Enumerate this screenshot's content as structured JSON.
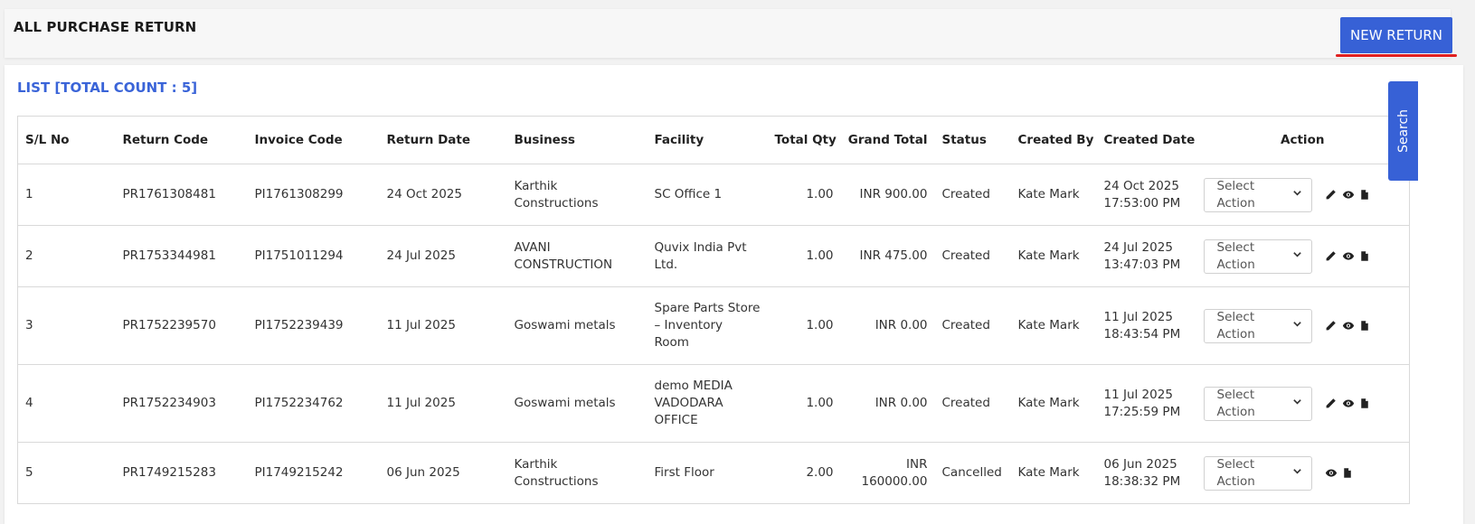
{
  "header": {
    "title": "ALL PURCHASE RETURN",
    "new_return_label": "NEW RETURN"
  },
  "list": {
    "title": "LIST [TOTAL COUNT : 5]",
    "columns": [
      "S/L No",
      "Return Code",
      "Invoice Code",
      "Return Date",
      "Business",
      "Facility",
      "Total Qty",
      "Grand Total",
      "Status",
      "Created By",
      "Created Date",
      "Action"
    ],
    "action_placeholder": "Select Action",
    "rows": [
      {
        "sl": "1",
        "return_code": "PR1761308481",
        "invoice_code": "PI1761308299",
        "return_date": "24 Oct 2025",
        "business": "Karthik Constructions",
        "facility": "SC Office 1",
        "total_qty": "1.00",
        "grand_total": "INR 900.00",
        "status": "Created",
        "created_by": "Kate Mark",
        "created_date": "24 Oct 2025 17:53:00 PM",
        "icons": [
          "edit-icon",
          "view-icon",
          "document-icon"
        ]
      },
      {
        "sl": "2",
        "return_code": "PR1753344981",
        "invoice_code": "PI1751011294",
        "return_date": "24 Jul 2025",
        "business": "AVANI CONSTRUCTION",
        "facility": "Quvix India Pvt Ltd.",
        "total_qty": "1.00",
        "grand_total": "INR 475.00",
        "status": "Created",
        "created_by": "Kate Mark",
        "created_date": "24 Jul 2025 13:47:03 PM",
        "icons": [
          "edit-icon",
          "view-icon",
          "document-icon"
        ]
      },
      {
        "sl": "3",
        "return_code": "PR1752239570",
        "invoice_code": "PI1752239439",
        "return_date": "11 Jul 2025",
        "business": "Goswami metals",
        "facility": "Spare Parts Store – Inventory Room",
        "total_qty": "1.00",
        "grand_total": "INR 0.00",
        "status": "Created",
        "created_by": "Kate Mark",
        "created_date": "11 Jul 2025 18:43:54 PM",
        "icons": [
          "edit-icon",
          "view-icon",
          "document-icon"
        ]
      },
      {
        "sl": "4",
        "return_code": "PR1752234903",
        "invoice_code": "PI1752234762",
        "return_date": "11 Jul 2025",
        "business": "Goswami metals",
        "facility": "demo MEDIA VADODARA OFFICE",
        "total_qty": "1.00",
        "grand_total": "INR 0.00",
        "status": "Created",
        "created_by": "Kate Mark",
        "created_date": "11 Jul 2025 17:25:59 PM",
        "icons": [
          "edit-icon",
          "view-icon",
          "document-icon"
        ]
      },
      {
        "sl": "5",
        "return_code": "PR1749215283",
        "invoice_code": "PI1749215242",
        "return_date": "06 Jun 2025",
        "business": "Karthik Constructions",
        "facility": "First Floor",
        "total_qty": "2.00",
        "grand_total": "INR 160000.00",
        "status": "Cancelled",
        "created_by": "Kate Mark",
        "created_date": "06 Jun 2025 18:38:32 PM",
        "icons": [
          "view-icon",
          "document-icon"
        ]
      }
    ]
  },
  "search_tab": {
    "label": "Search"
  },
  "colors": {
    "accent": "#3761d6",
    "underline": "#e02020",
    "list_title": "#3a64d8"
  }
}
